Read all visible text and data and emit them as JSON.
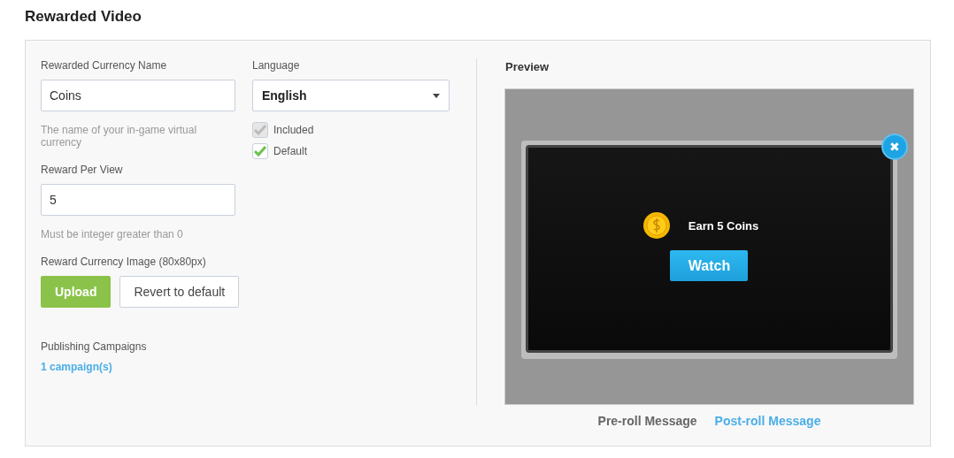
{
  "page_title": "Rewarded Video",
  "currency_name": {
    "label": "Rewarded Currency Name",
    "value": "Coins",
    "help": "The name of your in-game virtual currency"
  },
  "reward_per_view": {
    "label": "Reward Per View",
    "value": "5",
    "help": "Must be integer greater than 0"
  },
  "currency_image": {
    "label": "Reward Currency Image (80x80px)",
    "buttons": [
      {
        "label": "Upload",
        "kind": "primary"
      },
      {
        "label": "Revert to default",
        "kind": "secondary"
      }
    ]
  },
  "publishing": {
    "label": "Publishing Campaigns",
    "link": "1 campaign(s)"
  },
  "language": {
    "label": "Language",
    "value": "English",
    "options": [
      {
        "label": "Included",
        "checked": true,
        "disabled": true
      },
      {
        "label": "Default",
        "checked": true,
        "disabled": false
      }
    ]
  },
  "preview": {
    "title": "Preview",
    "message": "Earn 5 Coins",
    "button": "Watch",
    "close": "✖",
    "tabs": [
      {
        "label": "Pre-roll Message",
        "selected": true
      },
      {
        "label": "Post-roll Message",
        "selected": false
      }
    ]
  }
}
